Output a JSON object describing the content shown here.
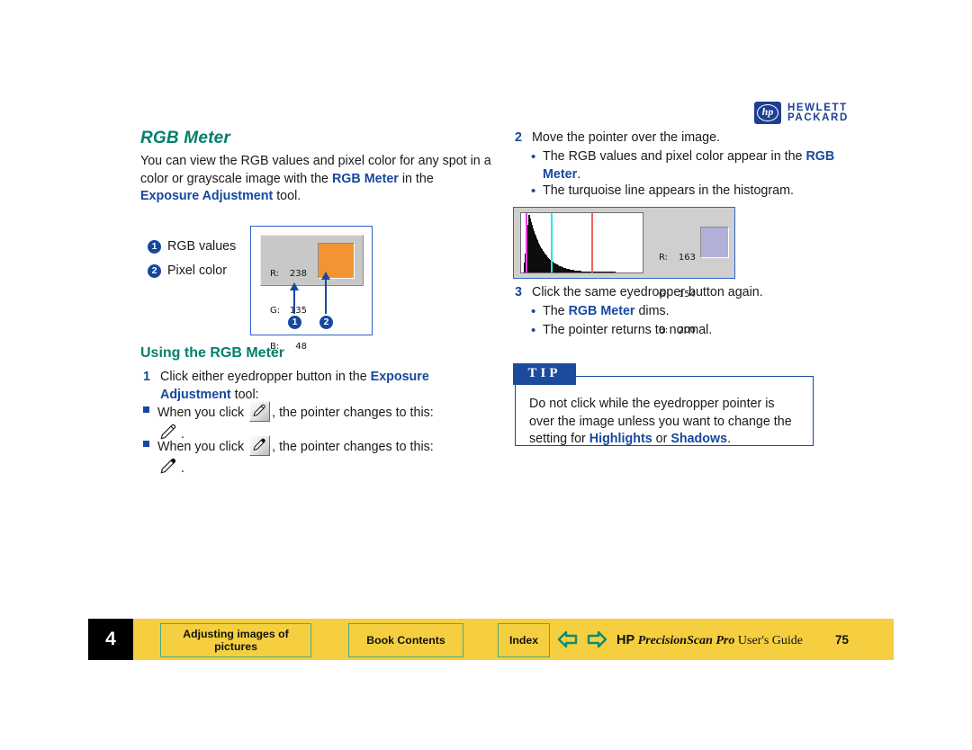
{
  "logo": {
    "badge": "hp",
    "line1": "HEWLETT",
    "line2": "PACKARD"
  },
  "left": {
    "title": "RGB Meter",
    "intro": {
      "part1": "You can view the RGB values and pixel color for any spot in a color or grayscale image with the ",
      "term1": "RGB Meter",
      "part2": " in the ",
      "term2": "Exposure Adjustment",
      "part3": " tool."
    },
    "callouts": [
      {
        "num": "1",
        "label": "RGB values"
      },
      {
        "num": "2",
        "label": "Pixel color"
      }
    ],
    "figure": {
      "rows": [
        {
          "label": "R:",
          "value": "238"
        },
        {
          "label": "G:",
          "value": "135"
        },
        {
          "label": "B:",
          "value": "48"
        }
      ],
      "swatch_color": "#f29433",
      "marker1": "1",
      "marker2": "2"
    },
    "subtitle": "Using the RGB Meter",
    "step1": {
      "num": "1",
      "text_a": "Click either eyedropper button in the ",
      "term_a": "Exposure Adjustment",
      "text_b": " tool:"
    },
    "bullets": [
      {
        "before": "When you click ",
        "icon": "eyedropper-white-icon",
        "after": ", the pointer changes to this:",
        "cursor": "eyedropper-white-cursor-icon",
        "period": "."
      },
      {
        "before": "When you click ",
        "icon": "eyedropper-black-icon",
        "after": ", the pointer changes to this:",
        "cursor": "eyedropper-black-cursor-icon",
        "period": "."
      }
    ]
  },
  "right": {
    "step2": {
      "num": "2",
      "text": "Move the pointer over the image."
    },
    "step2_bullets": [
      {
        "text_a": "The RGB values and pixel color appear in the ",
        "term": "RGB Meter",
        "text_b": "."
      },
      {
        "text_a": "The turquoise line appears in the histogram.",
        "term": "",
        "text_b": ""
      }
    ],
    "histogram": {
      "rows": [
        {
          "label": "R:",
          "value": "163"
        },
        {
          "label": "G:",
          "value": "154"
        },
        {
          "label": "B:",
          "value": "200"
        }
      ],
      "swatch_color": "#b3b0d8",
      "line_magenta": "#ec3fe0",
      "line_cyan": "#21e8e8",
      "line_red": "#f0645a"
    },
    "step3": {
      "num": "3",
      "text": "Click the same eyedropper button again."
    },
    "step3_bullets": [
      {
        "text_a": "The ",
        "term": "RGB Meter",
        "text_b": " dims."
      },
      {
        "text_a": "The pointer returns to normal.",
        "term": "",
        "text_b": ""
      }
    ],
    "tip": {
      "label": "TIP",
      "text_a": "Do not click while the eyedropper pointer is over the image unless you want to change the setting for ",
      "term_a": "Highlights",
      "text_b": " or ",
      "term_b": "Shadows",
      "text_c": "."
    }
  },
  "footer": {
    "chapter": "4",
    "btn_section": "Adjusting images of pictures",
    "btn_contents": "Book Contents",
    "btn_index": "Index",
    "brand_hp": "HP",
    "brand_product": "PrecisionScan Pro",
    "brand_suffix": " User's Guide",
    "page": "75"
  },
  "colors": {
    "heading_teal": "#00806b",
    "link_blue": "#16489e",
    "footer_yellow": "#f5cf3f",
    "tip_blue": "#1c4b9c"
  }
}
